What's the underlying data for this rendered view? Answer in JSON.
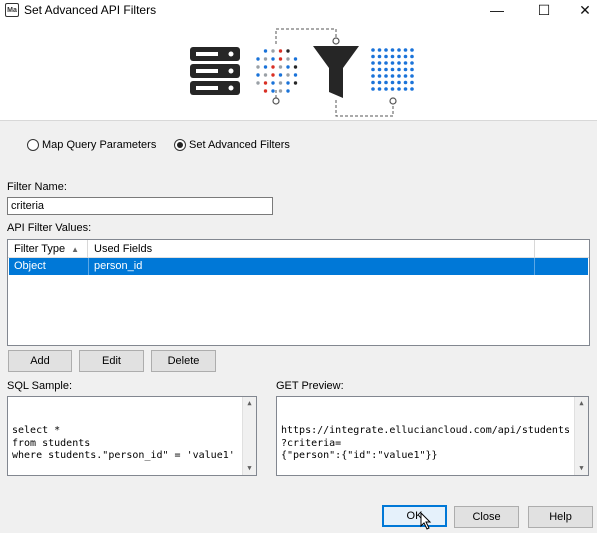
{
  "window": {
    "icon_text": "Ma",
    "title": "Set Advanced API Filters",
    "minimize": "—",
    "maximize": "☐",
    "close": "✕"
  },
  "mode": {
    "options": [
      {
        "label": "Map Query Parameters",
        "checked": false
      },
      {
        "label": "Set Advanced Filters",
        "checked": true
      }
    ]
  },
  "filter_name": {
    "label": "Filter Name:",
    "value": "criteria"
  },
  "filter_values": {
    "label": "API Filter Values:",
    "columns": [
      "Filter Type",
      "Used Fields"
    ],
    "rows": [
      {
        "filter_type": "Object",
        "used_fields": "person_id",
        "selected": true
      }
    ]
  },
  "actions": {
    "add": "Add",
    "edit": "Edit",
    "delete": "Delete"
  },
  "sql_sample": {
    "label": "SQL Sample:",
    "text": "select *\nfrom students\nwhere students.\"person_id\" = 'value1'"
  },
  "get_preview": {
    "label": "GET Preview:",
    "text": "https://integrate.elluciancloud.com/api/students\n?criteria=\n{\"person\":{\"id\":\"value1\"}}"
  },
  "footer": {
    "ok": "OK",
    "close": "Close",
    "help": "Help"
  },
  "colors": {
    "selection": "#0078d7",
    "dots_blue": "#1a73d9",
    "dots_gray": "#9aa0a6",
    "dots_red": "#d93025",
    "dark_icon": "#262626"
  }
}
